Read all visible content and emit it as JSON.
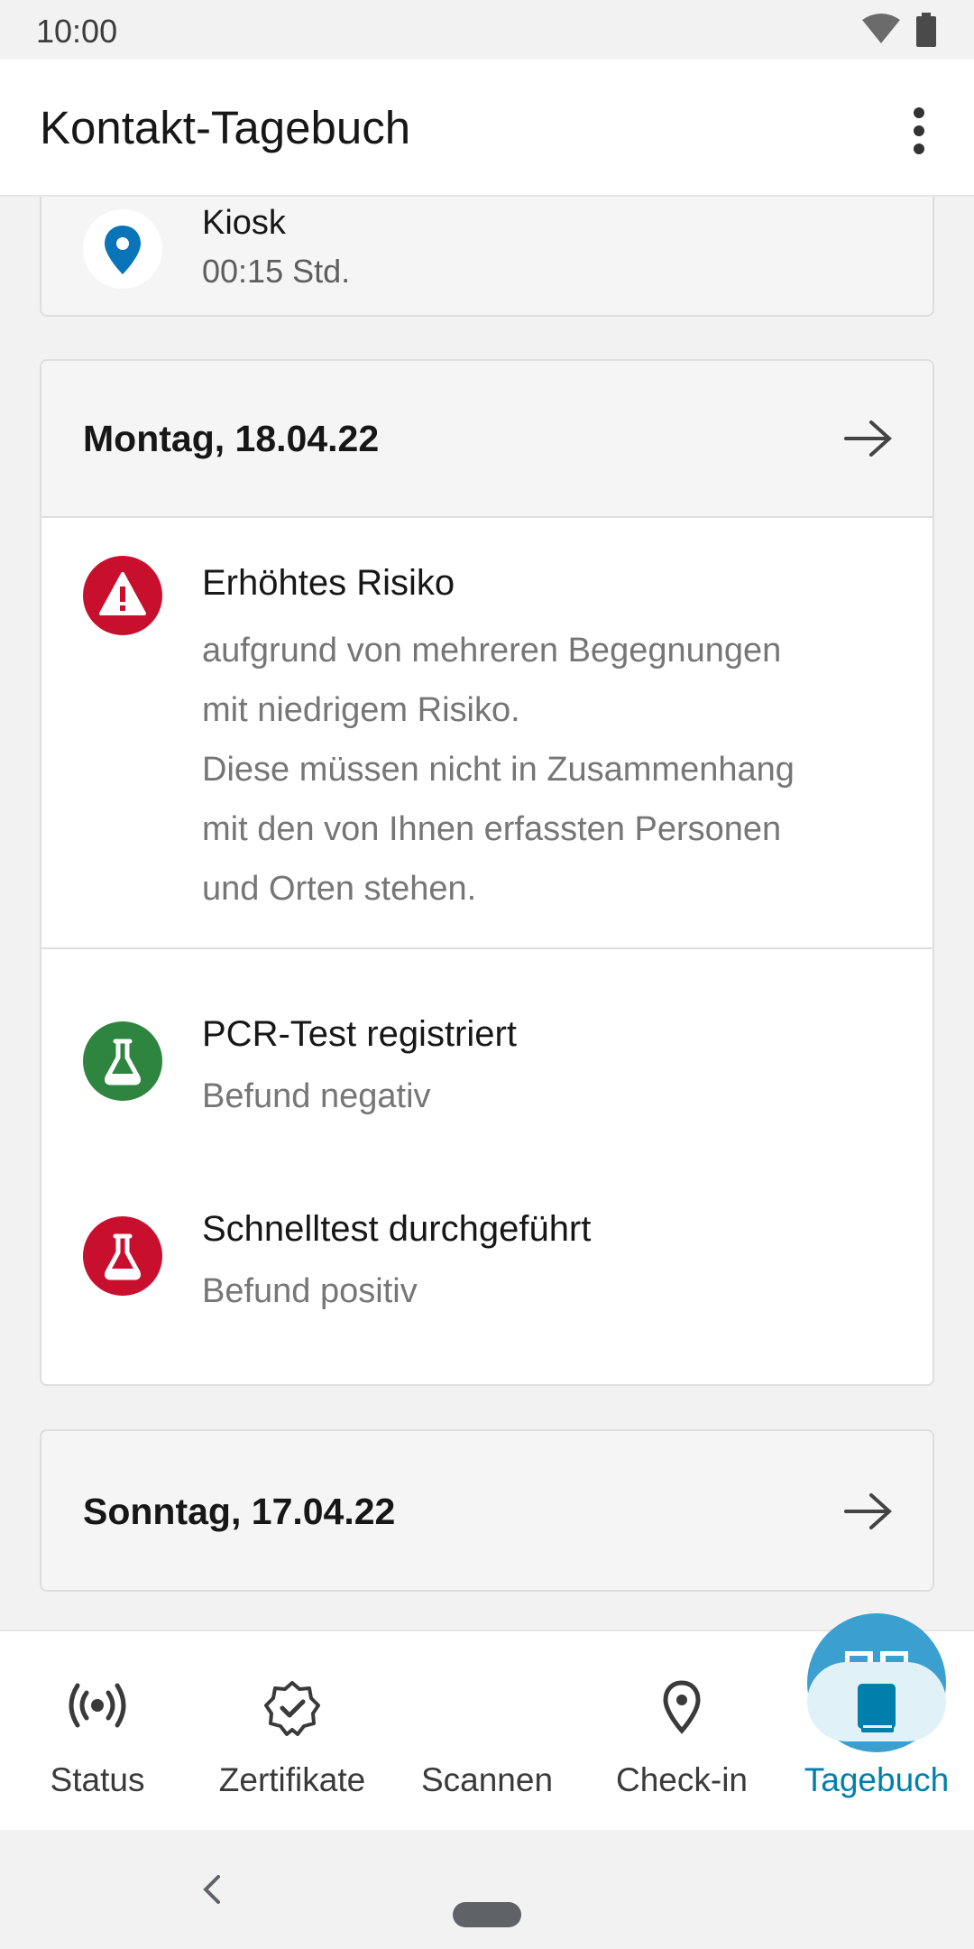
{
  "status_bar": {
    "time": "10:00",
    "icons": [
      "wifi-icon",
      "battery-icon"
    ]
  },
  "app_bar": {
    "title": "Kontakt-Tagebuch",
    "menu_icon": "more-vertical-icon"
  },
  "location_entry": {
    "icon": "location-pin-icon",
    "name": "Kiosk",
    "duration": "00:15 Std."
  },
  "days": [
    {
      "label": "Montag, 18.04.22",
      "risk": {
        "icon": "warning-icon",
        "title": "Erhöhtes Risiko",
        "lines": [
          "aufgrund von mehreren Begegnungen",
          "mit niedrigem Risiko.",
          "Diese müssen nicht in Zusammenhang",
          "mit den von Ihnen erfassten Personen",
          "und Orten stehen."
        ]
      },
      "tests": [
        {
          "icon": "flask-icon",
          "title": "PCR-Test registriert",
          "result": "Befund negativ",
          "color": "#2e8540"
        },
        {
          "icon": "flask-icon",
          "title": "Schnelltest durchgeführt",
          "result": "Befund positiv",
          "color": "#c8102e"
        }
      ]
    },
    {
      "label": "Sonntag, 17.04.22"
    }
  ],
  "bottom_nav": {
    "items": [
      {
        "label": "Status",
        "icon": "broadcast-icon",
        "active": false
      },
      {
        "label": "Zertifikate",
        "icon": "certificate-badge-icon",
        "active": false
      },
      {
        "label": "Scannen",
        "icon": "qr-code-icon",
        "active": false
      },
      {
        "label": "Check-in",
        "icon": "location-pin-icon",
        "active": false
      },
      {
        "label": "Tagebuch",
        "icon": "book-icon",
        "active": true
      }
    ]
  },
  "colors": {
    "accent": "#007fad",
    "risk_red": "#c8102e",
    "green": "#2e8540",
    "location_blue": "#0a74b9",
    "scan_button": "#3b9fcf"
  }
}
